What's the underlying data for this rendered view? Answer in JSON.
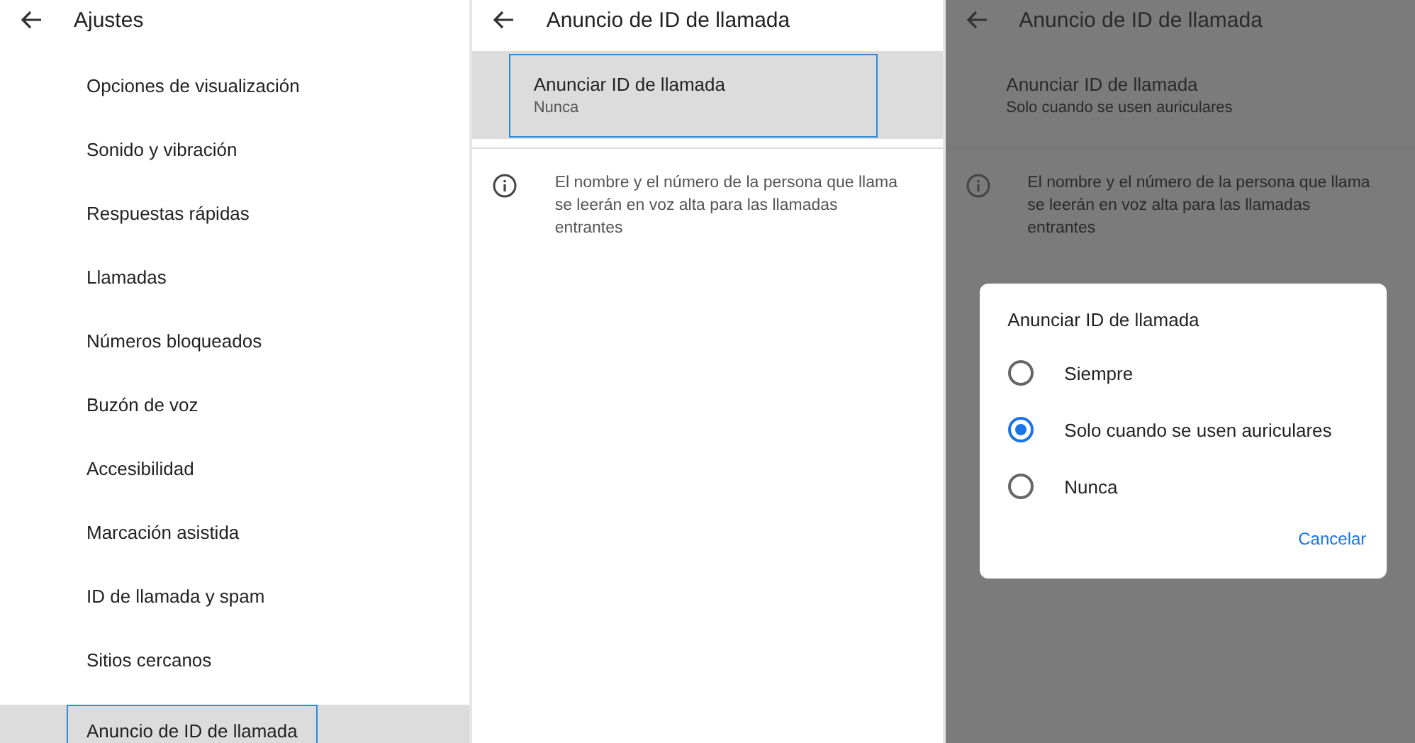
{
  "settings_screen": {
    "title": "Ajustes",
    "items": [
      {
        "label": "Opciones de visualización",
        "selected": false
      },
      {
        "label": "Sonido y vibración",
        "selected": false
      },
      {
        "label": "Respuestas rápidas",
        "selected": false
      },
      {
        "label": "Llamadas",
        "selected": false
      },
      {
        "label": "Números bloqueados",
        "selected": false
      },
      {
        "label": "Buzón de voz",
        "selected": false
      },
      {
        "label": "Accesibilidad",
        "selected": false
      },
      {
        "label": "Marcación asistida",
        "selected": false
      },
      {
        "label": "ID de llamada y spam",
        "selected": false
      },
      {
        "label": "Sitios cercanos",
        "selected": false
      },
      {
        "label": "Anuncio de ID de llamada",
        "selected": true
      }
    ]
  },
  "detail_screen": {
    "title": "Anuncio de ID de llamada",
    "setting": {
      "title": "Anunciar ID de llamada",
      "value": "Nunca",
      "selected": true
    },
    "info": "El nombre y el número de la persona que llama se leerán en voz alta para las llamadas entrantes"
  },
  "dialog_screen": {
    "title": "Anuncio de ID de llamada",
    "setting": {
      "title": "Anunciar ID de llamada",
      "value": "Solo cuando se usen auriculares",
      "selected": false
    },
    "info": "El nombre y el número de la persona que llama se leerán en voz alta para las llamadas entrantes",
    "dialog": {
      "title": "Anunciar ID de llamada",
      "options": [
        {
          "label": "Siempre",
          "selected": false
        },
        {
          "label": "Solo cuando se usen auriculares",
          "selected": true
        },
        {
          "label": "Nunca",
          "selected": false
        }
      ],
      "cancel": "Cancelar"
    }
  }
}
